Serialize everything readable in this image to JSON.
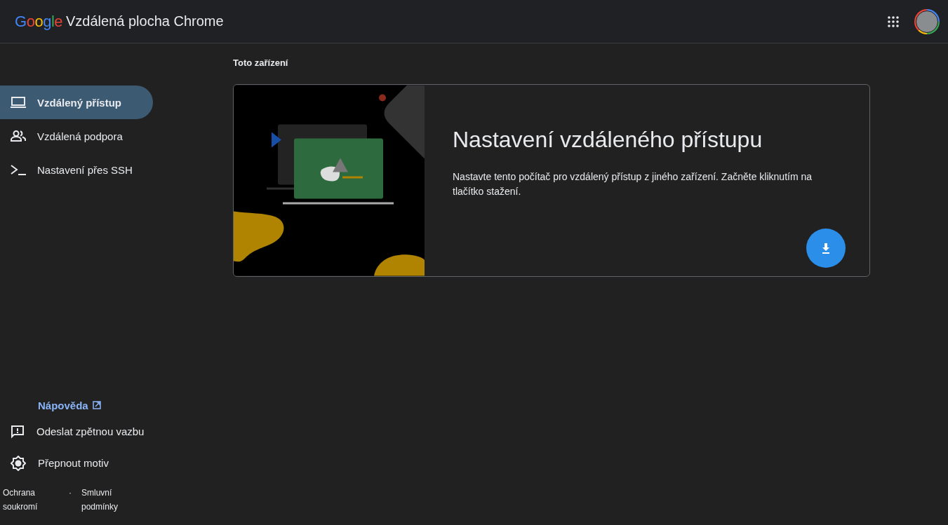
{
  "header": {
    "logo": "Google",
    "title": "Vzdálená plocha Chrome"
  },
  "sidebar": {
    "items": [
      {
        "label": "Vzdálený přístup",
        "kind": "laptop",
        "selected": true
      },
      {
        "label": "Vzdálená podpora",
        "kind": "people",
        "selected": false
      },
      {
        "label": "Nastavení přes SSH",
        "kind": "terminal",
        "selected": false
      }
    ],
    "help": "Nápověda",
    "actions": [
      {
        "label": "Odeslat zpětnou vazbu",
        "kind": "feedback"
      },
      {
        "label": "Přepnout motiv",
        "kind": "theme"
      }
    ],
    "footer": {
      "links": [
        "Ochrana soukromí",
        "Smluvní podmínky"
      ],
      "separator": "·"
    }
  },
  "main": {
    "section_title": "Toto zařízení",
    "card": {
      "title": "Nastavení vzdáleného přístupu",
      "text": "Nastavte tento počítač pro vzdálený přístup z jiného zařízení. Začněte kliknutím na tlačítko stažení."
    }
  }
}
